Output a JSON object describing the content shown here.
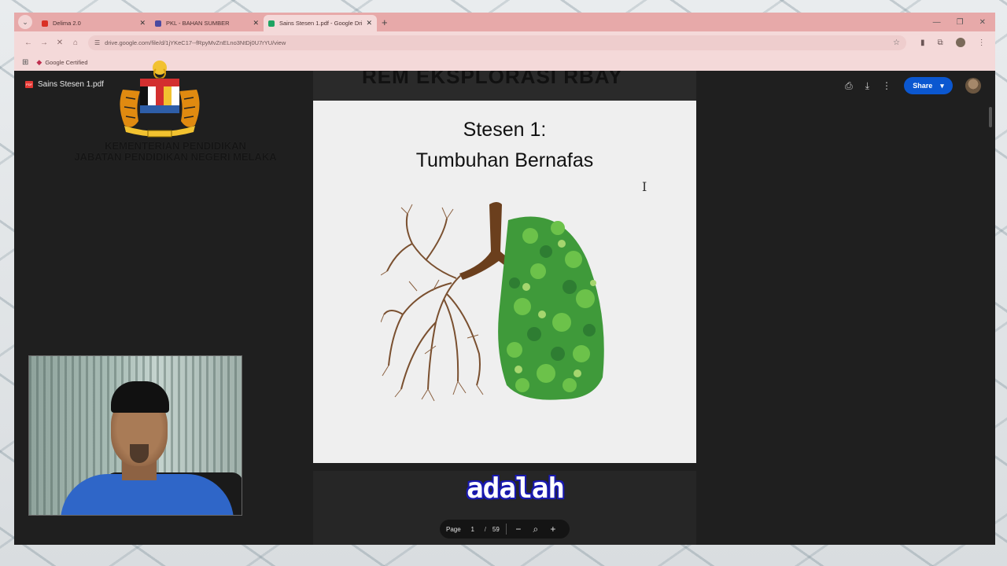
{
  "browser": {
    "tabs": [
      {
        "title": "Delima 2.0",
        "favicon_color": "#d93025",
        "active": false
      },
      {
        "title": "PKL - BAHAN SUMBER",
        "favicon_color": "#4a4aa0",
        "active": false
      },
      {
        "title": "Sains Stesen 1.pdf - Google Dri",
        "favicon_color": "#1fa463",
        "active": true
      }
    ],
    "new_tab": "+",
    "url": "drive.google.com/file/d/1jYKeC17--fRpyMvZnELno3NtDj0U7rYU/view",
    "bookmarks": [
      {
        "label": "Google Certified"
      }
    ]
  },
  "viewer": {
    "file_name": "Sains Stesen 1.pdf",
    "share_label": "Share",
    "prev_page_text": "REM EKSPLORASI RBAY",
    "slide": {
      "line1": "Stesen 1:",
      "line2": "Tumbuhan Bernafas"
    },
    "page_control": {
      "label": "Page",
      "current": "1",
      "separator": "/",
      "total": "59"
    }
  },
  "overlay": {
    "ministry_line1": "KEMENTERIAN PENDIDIKAN",
    "ministry_line2": "JABATAN PENDIDIKAN NEGERI MELAKA",
    "subtitle": "adalah"
  },
  "colors": {
    "tabstrip": "#e7a9a9",
    "share_button": "#0b57d0",
    "subtitle_outline": "#1a1ab0"
  }
}
